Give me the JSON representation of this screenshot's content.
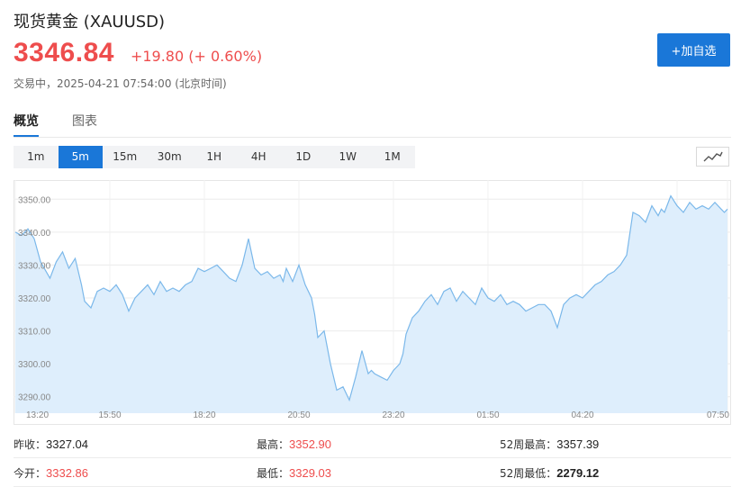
{
  "header": {
    "title": "现货黄金 (XAUUSD)",
    "price": "3346.84",
    "change": "+19.80 (+ 0.60%)",
    "status": "交易中，2025-04-21 07:54:00 (北京时间)",
    "add_button": "+加自选",
    "accent_color": "#ee4d4d",
    "brand_color": "#1a77d8"
  },
  "tabs": [
    {
      "label": "概览",
      "active": true
    },
    {
      "label": "图表",
      "active": false
    }
  ],
  "periods": [
    {
      "label": "1m",
      "active": false
    },
    {
      "label": "5m",
      "active": true
    },
    {
      "label": "15m",
      "active": false
    },
    {
      "label": "30m",
      "active": false
    },
    {
      "label": "1H",
      "active": false
    },
    {
      "label": "4H",
      "active": false
    },
    {
      "label": "1D",
      "active": false
    },
    {
      "label": "1W",
      "active": false
    },
    {
      "label": "1M",
      "active": false
    }
  ],
  "chart_type_icon": "line-chart-icon",
  "chart_data": {
    "type": "area",
    "title": "",
    "xlabel": "",
    "ylabel": "",
    "ylim": [
      3285,
      3355
    ],
    "yticks": [
      3290,
      3300,
      3310,
      3320,
      3330,
      3340,
      3350
    ],
    "ytick_labels": [
      "3290.00",
      "3300.00",
      "3310.00",
      "3320.00",
      "3330.00",
      "3340.00",
      "3350.00"
    ],
    "xlim": [
      0,
      1130
    ],
    "xticks": [
      0,
      150,
      300,
      450,
      600,
      750,
      900,
      1050,
      1130
    ],
    "xtick_labels": [
      "13:20",
      "15:50",
      "18:20",
      "20:50",
      "23:20",
      "01:50",
      "04:20",
      "07:50"
    ],
    "grid": true,
    "line_color": "#7bb8ea",
    "fill_color": "#deeefc",
    "series": [
      {
        "x": [
          0,
          10,
          20,
          30,
          40,
          55,
          65,
          75,
          85,
          95,
          105,
          110,
          120,
          130,
          140,
          150,
          160,
          170,
          180,
          190,
          200,
          210,
          220,
          230,
          240,
          250,
          260,
          270,
          280,
          290,
          300,
          310,
          320,
          330,
          340,
          350,
          360,
          370,
          380,
          390,
          400,
          410,
          420,
          425,
          430,
          440,
          450,
          460,
          470,
          475,
          480,
          490,
          500,
          510,
          520,
          530,
          540,
          550,
          560,
          565,
          570,
          580,
          590,
          600,
          610,
          615,
          620,
          630,
          640,
          650,
          660,
          670,
          680,
          690,
          700,
          710,
          720,
          730,
          740,
          750,
          760,
          770,
          780,
          790,
          800,
          810,
          820,
          830,
          840,
          850,
          860,
          870,
          880,
          890,
          900,
          910,
          920,
          930,
          940,
          950,
          960,
          970,
          980,
          990,
          1000,
          1010,
          1020,
          1025,
          1030,
          1040,
          1050,
          1060,
          1070,
          1080,
          1090,
          1100,
          1110,
          1120,
          1125,
          1130
        ],
        "y": [
          3340,
          3339,
          3341,
          3338,
          3331,
          3326,
          3331,
          3334,
          3329,
          3332,
          3324,
          3319,
          3317,
          3322,
          3323,
          3322,
          3324,
          3321,
          3316,
          3320,
          3322,
          3324,
          3321,
          3325,
          3322,
          3323,
          3322,
          3324,
          3325,
          3329,
          3328,
          3329,
          3330,
          3328,
          3326,
          3325,
          3330,
          3338,
          3329,
          3327,
          3328,
          3326,
          3327,
          3325,
          3329,
          3325,
          3330,
          3324,
          3320,
          3315,
          3308,
          3310,
          3300,
          3292,
          3293,
          3289,
          3296,
          3304,
          3297,
          3298,
          3297,
          3296,
          3295,
          3298,
          3300,
          3303,
          3309,
          3314,
          3316,
          3319,
          3321,
          3318,
          3322,
          3323,
          3319,
          3322,
          3320,
          3318,
          3323,
          3320,
          3319,
          3321,
          3318,
          3319,
          3318,
          3316,
          3317,
          3318,
          3318,
          3316,
          3311,
          3318,
          3320,
          3321,
          3320,
          3322,
          3324,
          3325,
          3327,
          3328,
          3330,
          3333,
          3346,
          3345,
          3343,
          3348,
          3345,
          3347,
          3346,
          3351,
          3348,
          3346,
          3349,
          3347,
          3348,
          3347,
          3349,
          3347,
          3346,
          3347
        ]
      }
    ]
  },
  "stats": {
    "prev_close_label": "昨收：",
    "prev_close": "3327.04",
    "open_label": "今开：",
    "open": "3332.86",
    "high_label": "最高：",
    "high": "3352.90",
    "low_label": "最低：",
    "low": "3329.03",
    "w52_high_label": "52周最高：",
    "w52_high": "3357.39",
    "w52_low_label": "52周最低：",
    "w52_low": "2279.12"
  }
}
